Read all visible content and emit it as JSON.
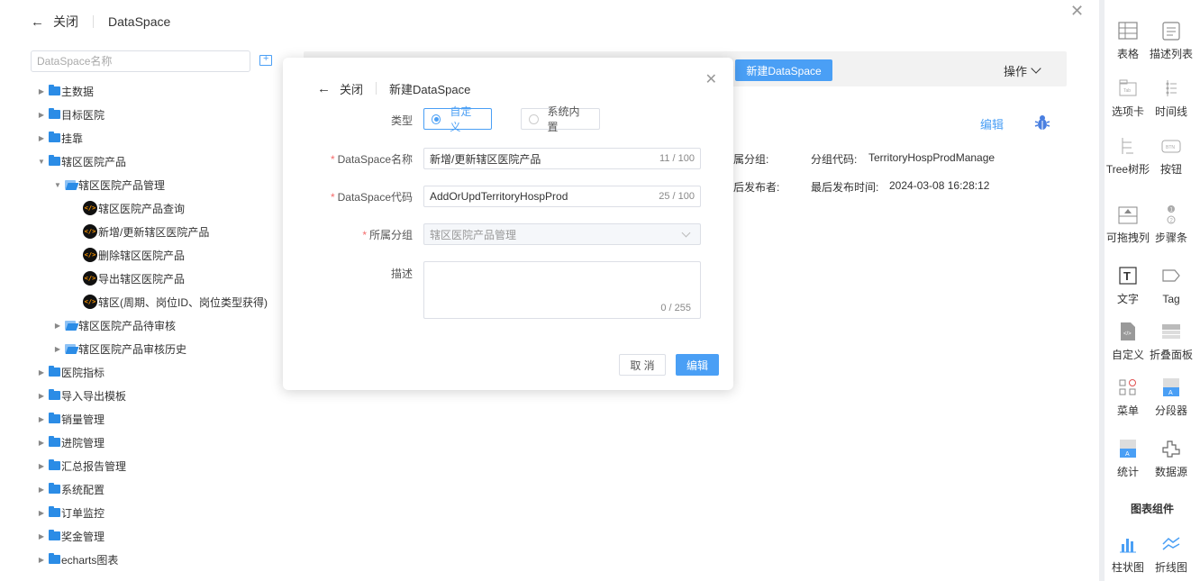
{
  "header": {
    "back_icon": "arrow-left-icon",
    "close_label": "关闭",
    "title": "DataSpace"
  },
  "search": {
    "placeholder": "DataSpace名称"
  },
  "tree": [
    {
      "label": "主数据",
      "type": "folder",
      "level": 0
    },
    {
      "label": "目标医院",
      "type": "folder",
      "level": 0
    },
    {
      "label": "挂靠",
      "type": "folder",
      "level": 0
    },
    {
      "label": "辖区医院产品",
      "type": "folder",
      "level": 0,
      "expanded": true
    },
    {
      "label": "辖区医院产品管理",
      "type": "group",
      "level": 1,
      "expanded": true
    },
    {
      "label": "辖区医院产品查询",
      "type": "api",
      "level": 2
    },
    {
      "label": "新增/更新辖区医院产品",
      "type": "api",
      "level": 2
    },
    {
      "label": "删除辖区医院产品",
      "type": "api",
      "level": 2
    },
    {
      "label": "导出辖区医院产品",
      "type": "api",
      "level": 2
    },
    {
      "label": "辖区(周期、岗位ID、岗位类型获得)",
      "type": "api",
      "level": 2
    },
    {
      "label": "辖区医院产品待审核",
      "type": "group",
      "level": 1
    },
    {
      "label": "辖区医院产品审核历史",
      "type": "group",
      "level": 1
    },
    {
      "label": "医院指标",
      "type": "folder",
      "level": 0
    },
    {
      "label": "导入导出模板",
      "type": "folder",
      "level": 0
    },
    {
      "label": "销量管理",
      "type": "folder",
      "level": 0
    },
    {
      "label": "进院管理",
      "type": "folder",
      "level": 0
    },
    {
      "label": "汇总报告管理",
      "type": "folder",
      "level": 0
    },
    {
      "label": "系统配置",
      "type": "folder",
      "level": 0
    },
    {
      "label": "订单监控",
      "type": "folder",
      "level": 0
    },
    {
      "label": "奖金管理",
      "type": "folder",
      "level": 0
    },
    {
      "label": "echarts图表",
      "type": "folder",
      "level": 0
    }
  ],
  "toolbar": {
    "new_button": "新建DataSpace",
    "ops_label": "操作"
  },
  "detail": {
    "edit_link": "编辑",
    "group_label": "属分组:",
    "group_code_label": "分组代码:",
    "group_code_value": "TerritoryHospProdManage",
    "publisher_label": "后发布者:",
    "publish_time_label": "最后发布时间:",
    "publish_time_value": "2024-03-08 16:28:12"
  },
  "dialog": {
    "close_label": "关闭",
    "title": "新建DataSpace",
    "type_label": "类型",
    "type_options": [
      "自定义",
      "系统内置"
    ],
    "type_selected": "自定义",
    "name_label": "DataSpace名称",
    "name_value": "新增/更新辖区医院产品",
    "name_count": "11 / 100",
    "code_label": "DataSpace代码",
    "code_value": "AddOrUpdTerritoryHospProd",
    "code_count": "25 / 100",
    "group_label": "所属分组",
    "group_value": "辖区医院产品管理",
    "desc_label": "描述",
    "desc_count": "0 / 255",
    "cancel_button": "取 消",
    "confirm_button": "编辑"
  },
  "right_panel": {
    "items": [
      {
        "label": "表格",
        "icon": "table-icon"
      },
      {
        "label": "描述列表",
        "icon": "description-list-icon"
      },
      {
        "label": "选项卡",
        "icon": "tabs-icon"
      },
      {
        "label": "时间线",
        "icon": "timeline-icon"
      },
      {
        "label": "Tree树形",
        "icon": "tree-icon"
      },
      {
        "label": "按钮",
        "icon": "button-icon"
      },
      {
        "label": "可拖拽列",
        "icon": "drag-column-icon"
      },
      {
        "label": "步骤条",
        "icon": "steps-icon"
      },
      {
        "label": "文字",
        "icon": "text-icon"
      },
      {
        "label": "Tag",
        "icon": "tag-icon"
      },
      {
        "label": "自定义",
        "icon": "custom-code-icon"
      },
      {
        "label": "折叠面板",
        "icon": "collapse-icon"
      },
      {
        "label": "菜单",
        "icon": "menu-icon"
      },
      {
        "label": "分段器",
        "icon": "segmented-icon"
      },
      {
        "label": "统计",
        "icon": "statistic-icon"
      },
      {
        "label": "数据源",
        "icon": "datasource-icon"
      }
    ],
    "chart_section_title": "图表组件",
    "chart_items": [
      {
        "label": "柱状图",
        "icon": "bar-chart-icon"
      },
      {
        "label": "折线图",
        "icon": "line-chart-icon"
      }
    ]
  },
  "colors": {
    "accent": "#4a9ff5",
    "folder": "#2b8ce6",
    "required": "#f56c6c"
  }
}
